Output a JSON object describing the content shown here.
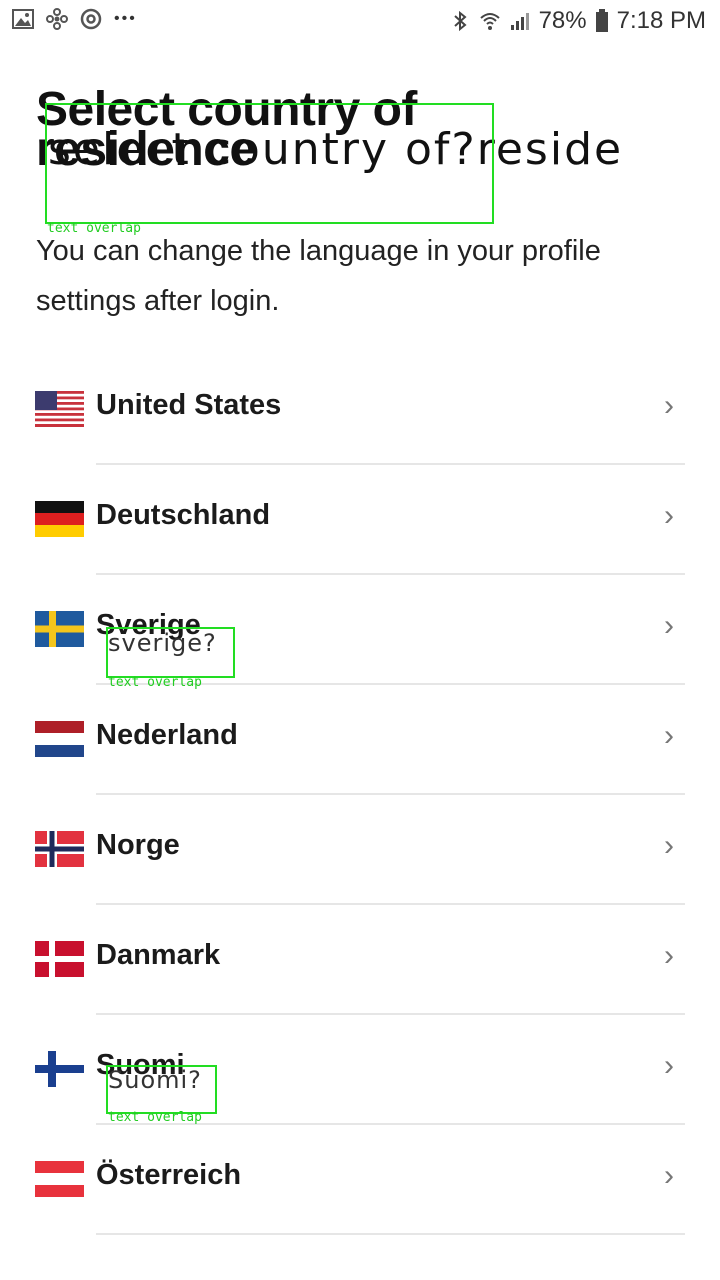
{
  "status_bar": {
    "battery": "78%",
    "time": "7:18 PM",
    "left_icons": [
      "image-icon",
      "fan-icon",
      "sync-icon",
      "more-dots-icon"
    ],
    "right_icons": [
      "bluetooth-icon",
      "wifi-icon",
      "signal-icon",
      "battery-icon"
    ],
    "more": "•••"
  },
  "header": {
    "title": "Select country of residence",
    "title_overlay": "select country of?reside",
    "subtitle": "You can change the language in your profile settings after login."
  },
  "overlay_label": "text overlap",
  "countries": [
    {
      "name": "United States",
      "flag": "us"
    },
    {
      "name": "Deutschland",
      "flag": "de"
    },
    {
      "name": "Sverige",
      "flag": "se",
      "overlay": "sverige?"
    },
    {
      "name": "Nederland",
      "flag": "nl"
    },
    {
      "name": "Norge",
      "flag": "no"
    },
    {
      "name": "Danmark",
      "flag": "dk"
    },
    {
      "name": "Suomi",
      "flag": "fi",
      "overlay": "Suomi?"
    },
    {
      "name": "Österreich",
      "flag": "at"
    }
  ],
  "chevron": "›"
}
